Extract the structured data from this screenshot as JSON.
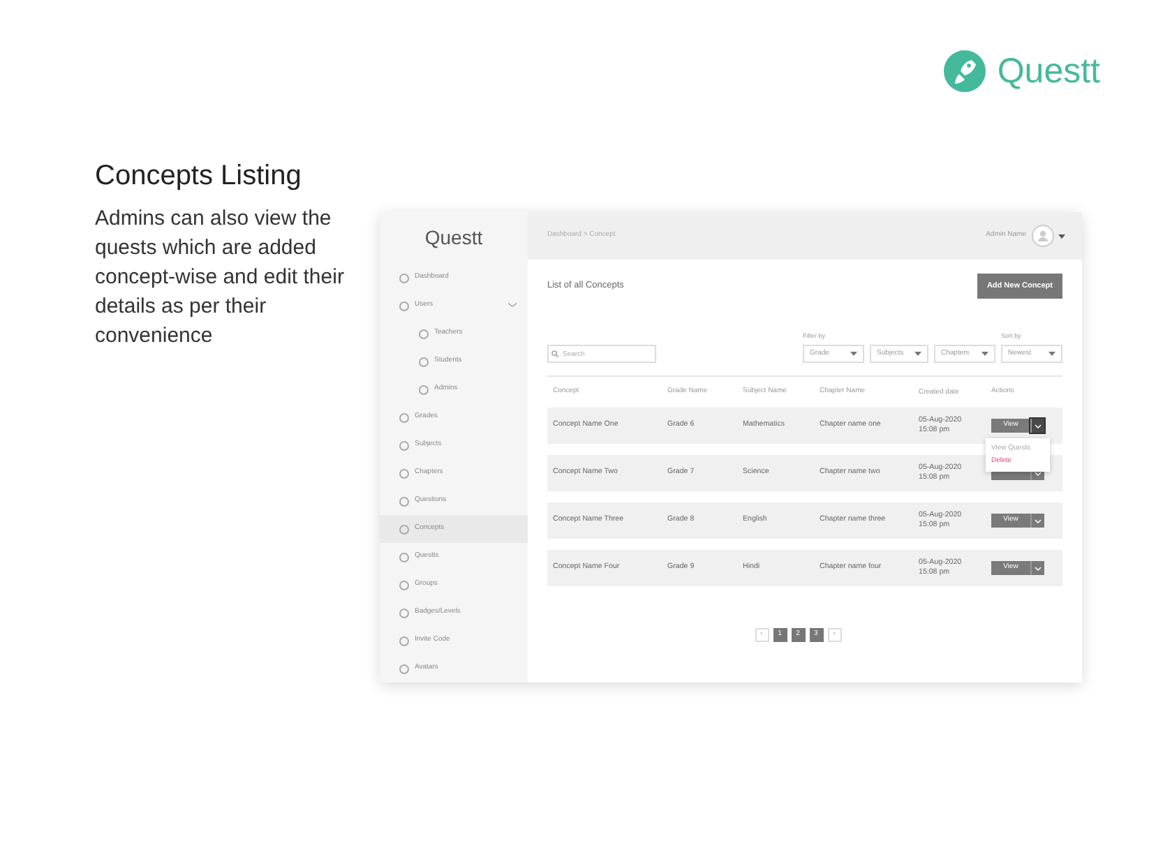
{
  "logo": {
    "text": "Questt"
  },
  "heading": "Concepts Listing",
  "description": "Admins can also view the quests which are added concept-wise and edit their details as per their convenience",
  "app": {
    "brand": "Questt",
    "sidebar": {
      "items": [
        {
          "label": "Dashboard",
          "selected": false
        },
        {
          "label": "Users",
          "selected": false,
          "expanded": true,
          "children": [
            {
              "label": "Teachers",
              "selected": false
            },
            {
              "label": "Students",
              "selected": false
            },
            {
              "label": "Admins",
              "selected": false
            }
          ]
        },
        {
          "label": "Grades",
          "selected": false
        },
        {
          "label": "Subjects",
          "selected": false
        },
        {
          "label": "Chapters",
          "selected": false
        },
        {
          "label": "Questions",
          "selected": false
        },
        {
          "label": "Concepts",
          "selected": true
        },
        {
          "label": "Questts",
          "selected": false
        },
        {
          "label": "Groups",
          "selected": false
        },
        {
          "label": "Badges/Levels",
          "selected": false
        },
        {
          "label": "Invite Code",
          "selected": false
        },
        {
          "label": "Avatars",
          "selected": false
        }
      ]
    },
    "breadcrumb": "Dashboard > Concept",
    "user": "Admin Name",
    "page_title": "List of all Concepts",
    "add_button": "Add New Concept",
    "search": {
      "placeholder": "Search"
    },
    "filter_label": "Filter by",
    "filters": [
      "Grade",
      "Subjects",
      "Chapters"
    ],
    "sort_label": "Sort by",
    "sort": "Newest",
    "table": {
      "columns": [
        "Concept",
        "Grade Name",
        "Subject Name",
        "Chapter Name",
        "Created date",
        "Actions"
      ],
      "rows": [
        {
          "cells": [
            "Concept Name One",
            "Grade 6",
            "Mathematics",
            "Chapter name one",
            "05-Aug-2020\n15:08 pm"
          ],
          "action": "View",
          "menu_open": true
        },
        {
          "cells": [
            "Concept Name Two",
            "Grade 7",
            "Science",
            "Chapter name two",
            "05-Aug-2020\n15:08 pm"
          ],
          "menu_open": false
        },
        {
          "cells": [
            "Concept Name Three",
            "Grade 8",
            "English",
            "Chapter name three",
            "05-Aug-2020\n15:08 pm"
          ],
          "action": "View",
          "menu_open": false
        },
        {
          "cells": [
            "Concept Name Four",
            "Grade 9",
            "Hindi",
            "Chapter name four",
            "05-Aug-2020\n15:08 pm"
          ],
          "action": "View",
          "menu_open": false
        }
      ]
    },
    "action_menu": {
      "items": [
        {
          "label": "View Quests",
          "kind": "normal"
        },
        {
          "label": "Delete",
          "kind": "danger"
        }
      ]
    },
    "pagination": {
      "prev": "‹",
      "pages": [
        "1",
        "2",
        "3"
      ],
      "next": "›"
    }
  }
}
